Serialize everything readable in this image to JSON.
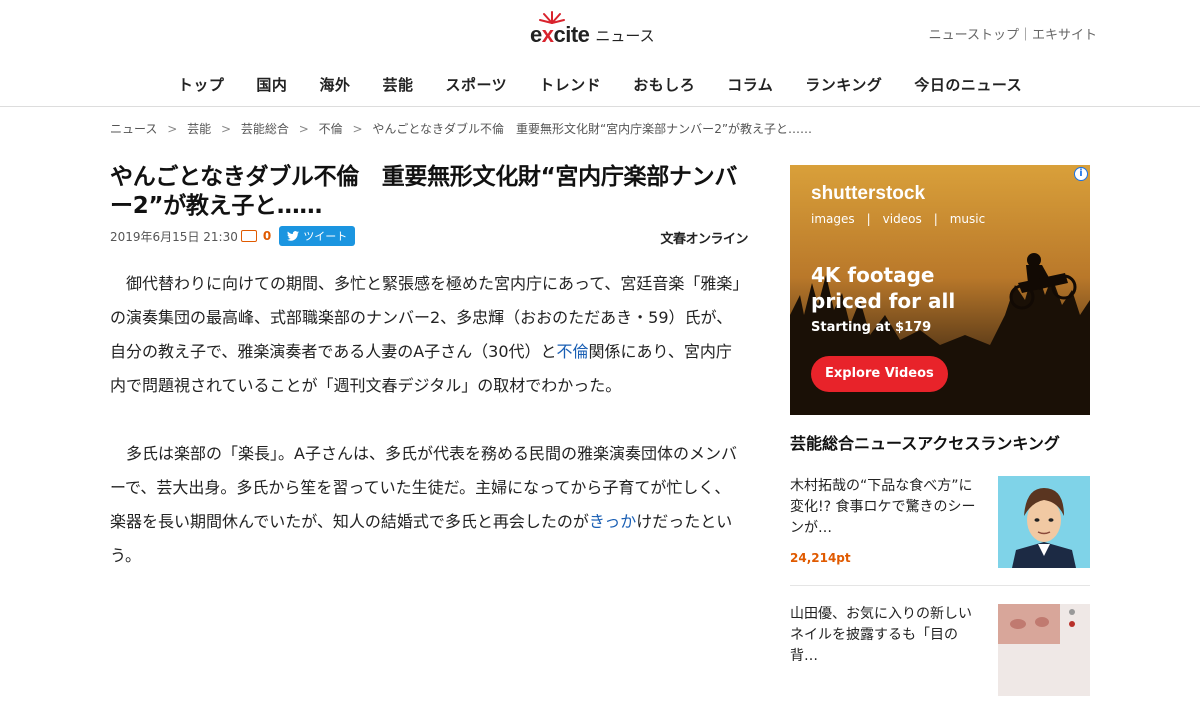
{
  "header": {
    "logo_pre": "e",
    "logo_x": "x",
    "logo_post": "cite",
    "logo_suffix": "ニュース",
    "toplinks": [
      "ニューストップ",
      "エキサイト"
    ],
    "toplink_separator": "｜",
    "nav": [
      "トップ",
      "国内",
      "海外",
      "芸能",
      "スポーツ",
      "トレンド",
      "おもしろ",
      "コラム",
      "ランキング",
      "今日のニュース"
    ]
  },
  "breadcrumb": {
    "items": [
      "ニュース",
      "芸能",
      "芸能総合",
      "不倫",
      "やんごとなきダブル不倫　重要無形文化財“宮内庁楽部ナンバー2”が教え子と……"
    ],
    "separator": ">"
  },
  "article": {
    "title": "やんごとなきダブル不倫　重要無形文化財“宮内庁楽部ナンバー2”が教え子と……",
    "date": "2019年6月15日 21:30",
    "comment_count": "0",
    "tweet_label": "ツイート",
    "source": "文春オンライン",
    "paragraphs": [
      {
        "before": "　御代替わりに向けての期間、多忙と緊張感を極めた宮内庁にあって、宮廷音楽「雅楽」の演奏集団の最高峰、式部職楽部のナンバー2、多忠輝（おおのただあき・59）氏が、自分の教え子で、雅楽演奏者である人妻のA子さん（30代）と",
        "link": "不倫",
        "after": "関係にあり、宮内庁内で問題視されていることが「週刊文春デジタル」の取材でわかった。"
      },
      {
        "before": "　多氏は楽部の「楽長」。A子さんは、多氏が代表を務める民間の雅楽演奏団体のメンバーで、芸大出身。多氏から笙を習っていた生徒だ。主婦になってから子育てが忙しく、楽器を長い期間休んでいたが、知人の結婚式で多氏と再会したのが",
        "link": "きっか",
        "after": "けだったという。"
      }
    ]
  },
  "ad": {
    "brand": "shutterstock",
    "sub": "images　|　videos　|　music",
    "headline_1": "4K footage",
    "headline_2": "priced for all",
    "price": "Starting at $179",
    "button": "Explore Videos",
    "info": "i"
  },
  "ranking": {
    "title": "芸能総合ニュースアクセスランキング",
    "items": [
      {
        "text": "木村拓哉の“下品な食べ方”に変化!? 食事ロケで驚きのシーンが…",
        "points": "24,214pt"
      },
      {
        "text": "山田優、お気に入りの新しいネイルを披露するも「目の背…",
        "points": ""
      }
    ]
  },
  "colors": {
    "accent_orange": "#e05a00",
    "link_blue": "#1a5fb4",
    "twitter_blue": "#1b95e0",
    "ad_button_red": "#e8232a"
  }
}
